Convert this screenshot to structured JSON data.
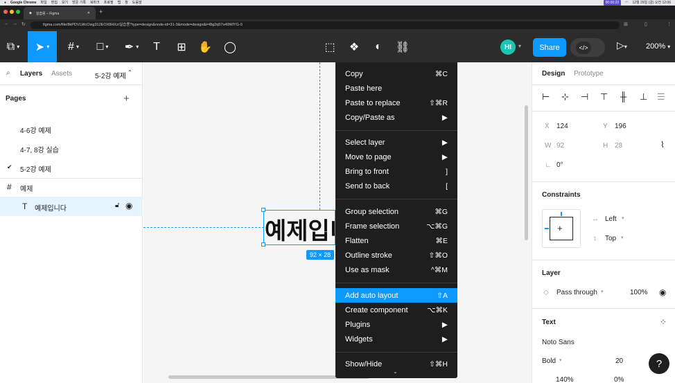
{
  "mac_menubar": {
    "app": "Google Chrome",
    "menus": [
      "파일",
      "편집",
      "보기",
      "방문 기록",
      "북마크",
      "프로필",
      "탭",
      "창",
      "도움말"
    ],
    "recording_time": "00:00:22",
    "datetime": "12월 29일 (금) 오전 12:06"
  },
  "browser": {
    "tab_title": "실습용 – Figma",
    "url": "figma.com/file/8kPDVLWcOsig312EOX8HXz/실습용?type=design&node-id=31-3&mode=design&t=l8g2q57o49WlYG-0"
  },
  "toolbar": {
    "share_label": "Share",
    "avatar_initials": "HI",
    "zoom": "200%",
    "dev_mode_icon": "</>"
  },
  "left_panel": {
    "tab_layers": "Layers",
    "tab_assets": "Assets",
    "current_page": "5-2강 예제",
    "pages_title": "Pages",
    "pages": [
      {
        "name": "4-6강 예제",
        "current": false
      },
      {
        "name": "4-7, 8강 실습",
        "current": false
      },
      {
        "name": "5-2강 예제",
        "current": true
      }
    ],
    "frame_name": "예제",
    "layer_name": "예제입니다"
  },
  "canvas": {
    "text": "예제입니다",
    "size_badge": "92 × 28"
  },
  "context_menu": {
    "groups": [
      [
        {
          "label": "Copy",
          "shortcut": "⌘C"
        },
        {
          "label": "Paste here",
          "shortcut": ""
        },
        {
          "label": "Paste to replace",
          "shortcut": "⇧⌘R"
        },
        {
          "label": "Copy/Paste as",
          "shortcut": "▶"
        }
      ],
      [
        {
          "label": "Select layer",
          "shortcut": "▶"
        },
        {
          "label": "Move to page",
          "shortcut": "▶"
        },
        {
          "label": "Bring to front",
          "shortcut": "]"
        },
        {
          "label": "Send to back",
          "shortcut": "["
        }
      ],
      [
        {
          "label": "Group selection",
          "shortcut": "⌘G"
        },
        {
          "label": "Frame selection",
          "shortcut": "⌥⌘G"
        },
        {
          "label": "Flatten",
          "shortcut": "⌘E"
        },
        {
          "label": "Outline stroke",
          "shortcut": "⇧⌘O"
        },
        {
          "label": "Use as mask",
          "shortcut": "^⌘M"
        }
      ],
      [
        {
          "label": "Add auto layout",
          "shortcut": "⇧A",
          "highlighted": true
        },
        {
          "label": "Create component",
          "shortcut": "⌥⌘K"
        },
        {
          "label": "Plugins",
          "shortcut": "▶"
        },
        {
          "label": "Widgets",
          "shortcut": "▶"
        }
      ],
      [
        {
          "label": "Show/Hide",
          "shortcut": "⇧⌘H"
        }
      ]
    ]
  },
  "right_panel": {
    "tab_design": "Design",
    "tab_prototype": "Prototype",
    "x_label": "X",
    "x": "124",
    "y_label": "Y",
    "y": "196",
    "w_label": "W",
    "w": "92",
    "h_label": "H",
    "h": "28",
    "rotation": "0°",
    "constraints_title": "Constraints",
    "constraint_h": "Left",
    "constraint_v": "Top",
    "layer_title": "Layer",
    "blend_mode": "Pass through",
    "opacity": "100%",
    "text_title": "Text",
    "font_family": "Noto Sans",
    "font_weight": "Bold",
    "font_size": "20",
    "line_height": "140%",
    "letter_spacing": "0%"
  },
  "colors": {
    "accent": "#0d99ff",
    "toolbar": "#2c2c2c",
    "menu_bg": "#1e1e1e"
  }
}
